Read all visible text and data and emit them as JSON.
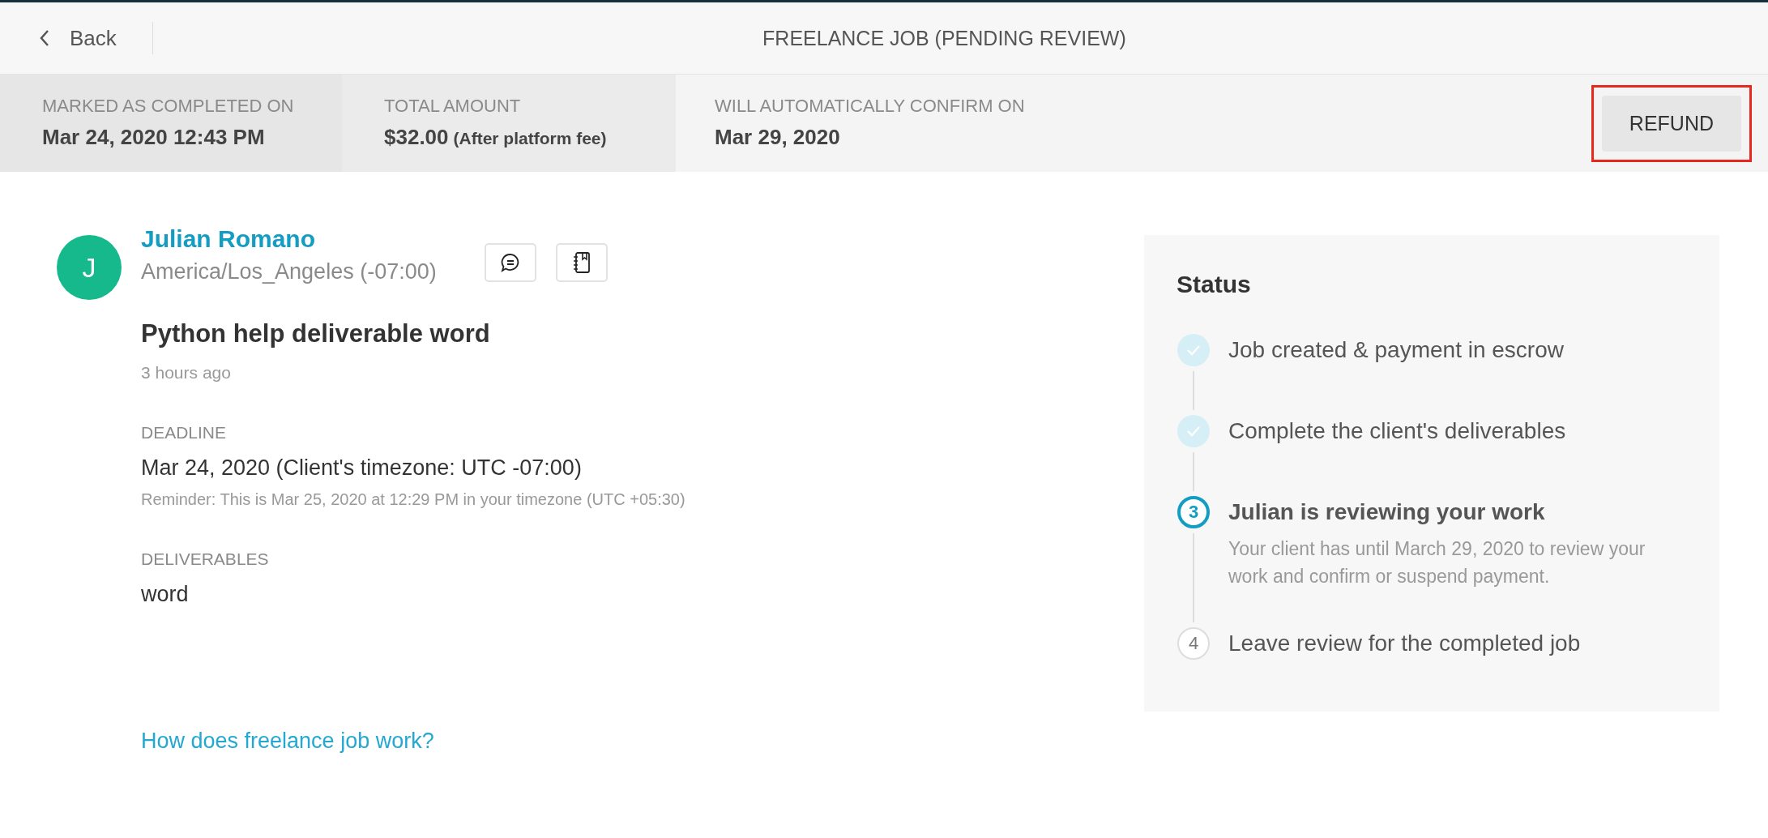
{
  "header": {
    "back_label": "Back",
    "title": "FREELANCE JOB (PENDING REVIEW)"
  },
  "summary": [
    {
      "label": "MARKED AS COMPLETED ON",
      "value": "Mar 24, 2020 12:43 PM"
    },
    {
      "label": "TOTAL AMOUNT",
      "value": "$32.00",
      "note": "(After platform fee)"
    },
    {
      "label": "WILL AUTOMATICALLY CONFIRM ON",
      "value": "Mar 29, 2020"
    }
  ],
  "refund_button": {
    "label": "REFUND",
    "highlighted": true
  },
  "client": {
    "initial": "J",
    "name": "Julian Romano",
    "timezone": "America/Los_Angeles (-07:00)"
  },
  "job": {
    "title": "Python help deliverable word",
    "posted": "3 hours ago",
    "deadline_label": "DEADLINE",
    "deadline": "Mar 24, 2020 (Client's timezone: UTC -07:00)",
    "reminder": "Reminder: This is Mar 25, 2020 at 12:29 PM in your timezone (UTC +05:30)",
    "deliverables_label": "DELIVERABLES",
    "deliverables": "word"
  },
  "help_link": "How does freelance job work?",
  "status": {
    "title": "Status",
    "steps": [
      {
        "done": true,
        "current": false,
        "label": "Job created & payment in escrow"
      },
      {
        "done": true,
        "current": false,
        "label": "Complete the client's deliverables"
      },
      {
        "done": false,
        "current": true,
        "number": "3",
        "label": "Julian is reviewing your work",
        "detail": "Your client has until March 29, 2020 to review your work and confirm or suspend payment."
      },
      {
        "done": false,
        "current": false,
        "number": "4",
        "label": "Leave review for the completed job"
      }
    ]
  }
}
